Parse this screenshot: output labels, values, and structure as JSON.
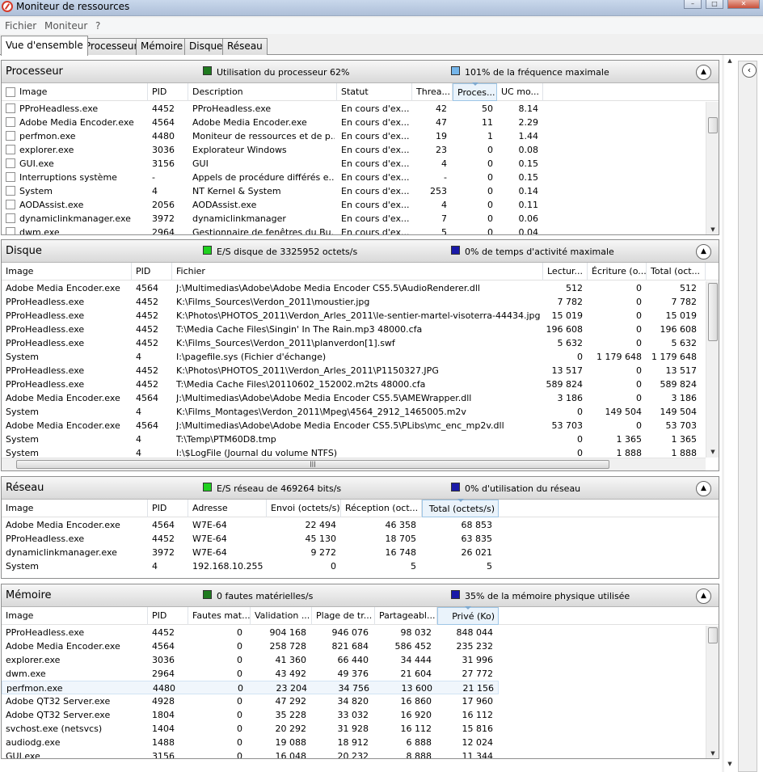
{
  "window": {
    "title": "Moniteur de ressources"
  },
  "menu": [
    "Fichier",
    "Moniteur",
    "?"
  ],
  "tabs": [
    "Vue d'ensemble",
    "Processeur",
    "Mémoire",
    "Disque",
    "Réseau"
  ],
  "colors": {
    "green": "#1fd11f",
    "dark_green": "#1f7a1f",
    "blue": "#1a1aa8",
    "light_blue": "#74b5ea"
  },
  "cpu": {
    "title": "Processeur",
    "stat1": "Utilisation du processeur 62%",
    "stat2": "101% de la fréquence maximale",
    "headers": [
      "Image",
      "PID",
      "Description",
      "Statut",
      "Threa...",
      "Proces...",
      "UC mo..."
    ],
    "rows": [
      [
        "PProHeadless.exe",
        "4452",
        "PProHeadless.exe",
        "En cours d'ex...",
        "42",
        "50",
        "8.14"
      ],
      [
        "Adobe Media Encoder.exe",
        "4564",
        "Adobe Media Encoder.exe",
        "En cours d'ex...",
        "47",
        "11",
        "2.29"
      ],
      [
        "perfmon.exe",
        "4480",
        "Moniteur de ressources et de p...",
        "En cours d'ex...",
        "19",
        "1",
        "1.44"
      ],
      [
        "explorer.exe",
        "3036",
        "Explorateur Windows",
        "En cours d'ex...",
        "23",
        "0",
        "0.08"
      ],
      [
        "GUI.exe",
        "3156",
        "GUI",
        "En cours d'ex...",
        "4",
        "0",
        "0.15"
      ],
      [
        "Interruptions système",
        "-",
        "Appels de procédure différés e...",
        "En cours d'ex...",
        "-",
        "0",
        "0.15"
      ],
      [
        "System",
        "4",
        "NT Kernel & System",
        "En cours d'ex...",
        "253",
        "0",
        "0.14"
      ],
      [
        "AODAssist.exe",
        "2056",
        "AODAssist.exe",
        "En cours d'ex...",
        "4",
        "0",
        "0.11"
      ],
      [
        "dynamiclinkmanager.exe",
        "3972",
        "dynamiclinkmanager",
        "En cours d'ex...",
        "7",
        "0",
        "0.06"
      ],
      [
        "dwm.exe",
        "2964",
        "Gestionnaire de fenêtres du Bu...",
        "En cours d'ex...",
        "5",
        "0",
        "0.04"
      ]
    ]
  },
  "disk": {
    "title": "Disque",
    "stat1": "E/S disque de 3325952 octets/s",
    "stat2": "0% de temps d'activité maximale",
    "headers": [
      "Image",
      "PID",
      "Fichier",
      "Lectur...",
      "Écriture (o...",
      "Total (oct..."
    ],
    "rows": [
      [
        "Adobe Media Encoder.exe",
        "4564",
        "J:\\Multimedias\\Adobe\\Adobe Media Encoder CS5.5\\AudioRenderer.dll",
        "512",
        "0",
        "512"
      ],
      [
        "PProHeadless.exe",
        "4452",
        "K:\\Films_Sources\\Verdon_2011\\moustier.jpg",
        "7 782",
        "0",
        "7 782"
      ],
      [
        "PProHeadless.exe",
        "4452",
        "K:\\Photos\\PHOTOS_2011\\Verdon_Arles_2011\\le-sentier-martel-visoterra-44434.jpg",
        "15 019",
        "0",
        "15 019"
      ],
      [
        "PProHeadless.exe",
        "4452",
        "T:\\Media Cache Files\\Singin' In The Rain.mp3 48000.cfa",
        "196 608",
        "0",
        "196 608"
      ],
      [
        "PProHeadless.exe",
        "4452",
        "K:\\Films_Sources\\Verdon_2011\\planverdon[1].swf",
        "5 632",
        "0",
        "5 632"
      ],
      [
        "System",
        "4",
        "I:\\pagefile.sys (Fichier d'échange)",
        "0",
        "1 179 648",
        "1 179 648"
      ],
      [
        "PProHeadless.exe",
        "4452",
        "K:\\Photos\\PHOTOS_2011\\Verdon_Arles_2011\\P1150327.JPG",
        "13 517",
        "0",
        "13 517"
      ],
      [
        "PProHeadless.exe",
        "4452",
        "T:\\Media Cache Files\\20110602_152002.m2ts 48000.cfa",
        "589 824",
        "0",
        "589 824"
      ],
      [
        "Adobe Media Encoder.exe",
        "4564",
        "J:\\Multimedias\\Adobe\\Adobe Media Encoder CS5.5\\AMEWrapper.dll",
        "3 186",
        "0",
        "3 186"
      ],
      [
        "System",
        "4",
        "K:\\Films_Montages\\Verdon_2011\\Mpeg\\4564_2912_1465005.m2v",
        "0",
        "149 504",
        "149 504"
      ],
      [
        "Adobe Media Encoder.exe",
        "4564",
        "J:\\Multimedias\\Adobe\\Adobe Media Encoder CS5.5\\PLibs\\mc_enc_mp2v.dll",
        "53 703",
        "0",
        "53 703"
      ],
      [
        "System",
        "4",
        "T:\\Temp\\PTM60D8.tmp",
        "0",
        "1 365",
        "1 365"
      ],
      [
        "System",
        "4",
        "I:\\$LogFile (Journal du volume NTFS)",
        "0",
        "1 888",
        "1 888"
      ]
    ]
  },
  "network": {
    "title": "Réseau",
    "stat1": "E/S réseau de 469264 bits/s",
    "stat2": "0% d'utilisation du réseau",
    "headers": [
      "Image",
      "PID",
      "Adresse",
      "Envoi (octets/s)",
      "Réception (oct...",
      "Total (octets/s)"
    ],
    "rows": [
      [
        "Adobe Media Encoder.exe",
        "4564",
        "W7E-64",
        "22 494",
        "46 358",
        "68 853"
      ],
      [
        "PProHeadless.exe",
        "4452",
        "W7E-64",
        "45 130",
        "18 705",
        "63 835"
      ],
      [
        "dynamiclinkmanager.exe",
        "3972",
        "W7E-64",
        "9 272",
        "16 748",
        "26 021"
      ],
      [
        "System",
        "4",
        "192.168.10.255",
        "0",
        "5",
        "5"
      ]
    ]
  },
  "memory": {
    "title": "Mémoire",
    "stat1": "0 fautes matérielles/s",
    "stat2": "35% de la mémoire physique utilisée",
    "headers": [
      "Image",
      "PID",
      "Fautes mat...",
      "Validation ...",
      "Plage de tr...",
      "Partageabl...",
      "Privé (Ko)"
    ],
    "rows": [
      [
        "PProHeadless.exe",
        "4452",
        "0",
        "904 168",
        "946 076",
        "98 032",
        "848 044"
      ],
      [
        "Adobe Media Encoder.exe",
        "4564",
        "0",
        "258 728",
        "821 684",
        "586 452",
        "235 232"
      ],
      [
        "explorer.exe",
        "3036",
        "0",
        "41 360",
        "66 440",
        "34 444",
        "31 996"
      ],
      [
        "dwm.exe",
        "2964",
        "0",
        "43 492",
        "49 376",
        "21 604",
        "27 772"
      ],
      [
        "perfmon.exe",
        "4480",
        "0",
        "23 204",
        "34 756",
        "13 600",
        "21 156"
      ],
      [
        "Adobe QT32 Server.exe",
        "4928",
        "0",
        "47 292",
        "34 820",
        "16 860",
        "17 960"
      ],
      [
        "Adobe QT32 Server.exe",
        "1804",
        "0",
        "35 228",
        "33 032",
        "16 920",
        "16 112"
      ],
      [
        "svchost.exe (netsvcs)",
        "1404",
        "0",
        "20 292",
        "31 928",
        "16 112",
        "15 816"
      ],
      [
        "audiodg.exe",
        "1488",
        "0",
        "19 088",
        "18 912",
        "6 888",
        "12 024"
      ],
      [
        "GUI.exe",
        "3156",
        "0",
        "16 048",
        "20 232",
        "8 888",
        "11 344"
      ]
    ]
  }
}
